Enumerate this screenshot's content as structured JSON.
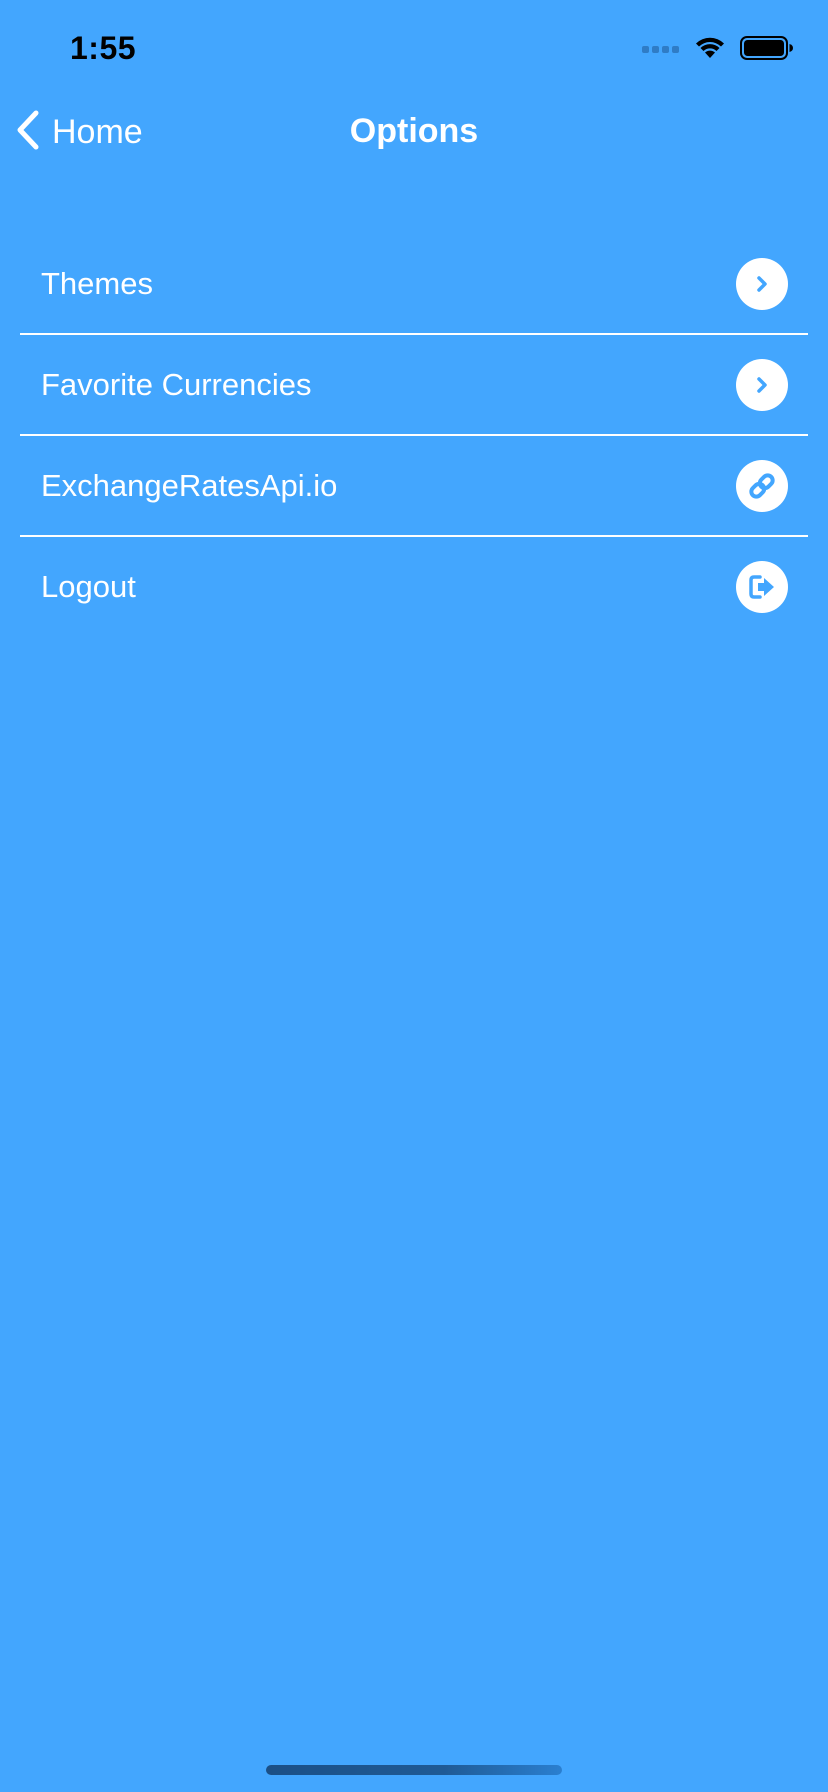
{
  "status_bar": {
    "time": "1:55",
    "icons": [
      "signal-icon",
      "wifi-icon",
      "battery-icon"
    ]
  },
  "nav": {
    "back_label": "Home",
    "title": "Options"
  },
  "options": [
    {
      "label": "Themes",
      "icon": "chevron-right-icon"
    },
    {
      "label": "Favorite Currencies",
      "icon": "chevron-right-icon"
    },
    {
      "label": "ExchangeRatesApi.io",
      "icon": "link-icon"
    },
    {
      "label": "Logout",
      "icon": "logout-icon"
    }
  ],
  "colors": {
    "background": "#43a6fe",
    "accent": "#43a6fe",
    "text": "#ffffff",
    "divider": "#ffffff"
  }
}
